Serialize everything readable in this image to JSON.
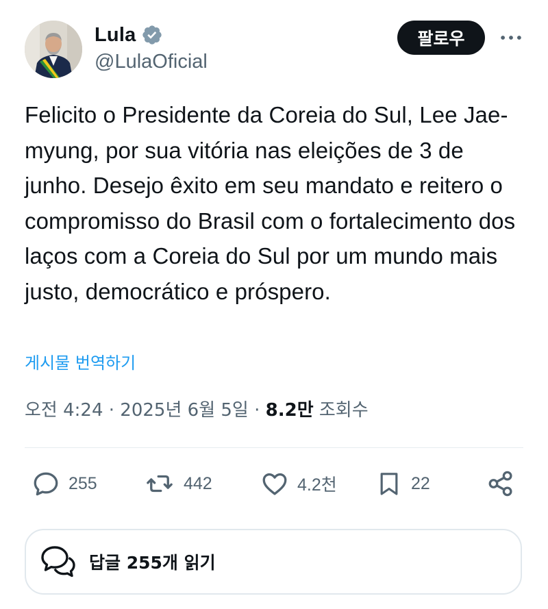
{
  "author": {
    "display_name": "Lula",
    "handle": "@LulaOficial",
    "verified": true
  },
  "header": {
    "follow_label": "팔로우",
    "more_icon": "more-horizontal-icon"
  },
  "tweet": {
    "text": "Felicito o Presidente da Coreia do Sul, Lee Jae-myung, por sua vitória nas eleições de 3 de junho. Desejo êxito em seu mandato e reitero o compromisso do Brasil com o fortalecimento dos laços com a Coreia do Sul por um mundo mais justo, democrático e próspero.",
    "translate_label": "게시물 번역하기"
  },
  "meta": {
    "time": "오전 4:24",
    "separator": " · ",
    "date": "2025년 6월 5일",
    "views_count": "8.2만",
    "views_label": " 조회수"
  },
  "actions": {
    "replies": "255",
    "reposts": "442",
    "likes": "4.2천",
    "bookmarks": "22"
  },
  "reply_bar": {
    "label": "답글 255개 읽기"
  },
  "colors": {
    "text_primary": "#0f1419",
    "text_secondary": "#536471",
    "link": "#1d9bf0",
    "verified_badge": "#829aab",
    "follow_bg": "#0f1419"
  }
}
